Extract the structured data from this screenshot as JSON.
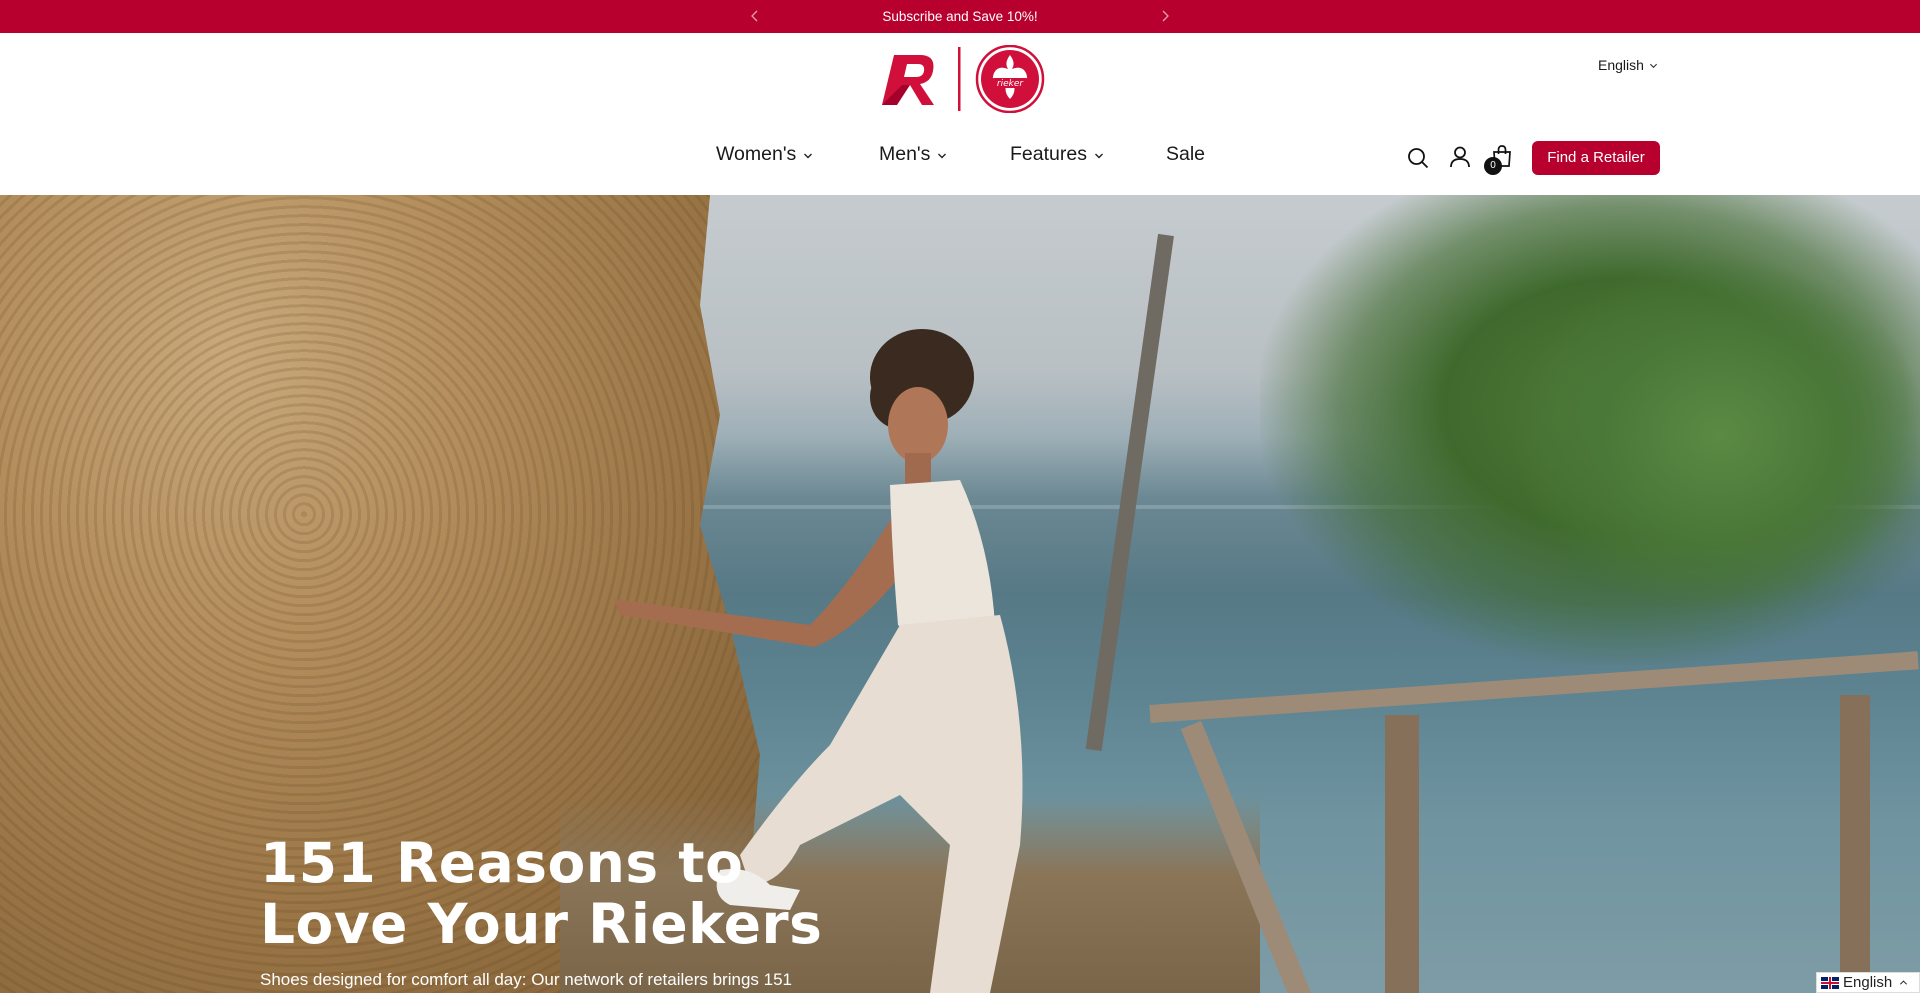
{
  "announcement": {
    "message": "Subscribe and Save 10%!"
  },
  "header": {
    "language": "English",
    "nav": [
      {
        "label": "Women's",
        "has_dropdown": true
      },
      {
        "label": "Men's",
        "has_dropdown": true
      },
      {
        "label": "Features",
        "has_dropdown": true
      },
      {
        "label": "Sale",
        "has_dropdown": false
      }
    ],
    "icons": [
      "search-icon",
      "account-icon",
      "cart-icon"
    ],
    "cart_count": "0",
    "find_retailer_label": "Find a Retailer",
    "logo_text": "rieker"
  },
  "hero": {
    "title": "151 Reasons to Love Your Riekers",
    "subtitle": "Shoes designed for comfort all day: Our network of retailers brings 151"
  },
  "language_widget": {
    "label": "English"
  },
  "colors": {
    "brand_red": "#b8002e",
    "text": "#1a1a1a",
    "white": "#ffffff"
  }
}
